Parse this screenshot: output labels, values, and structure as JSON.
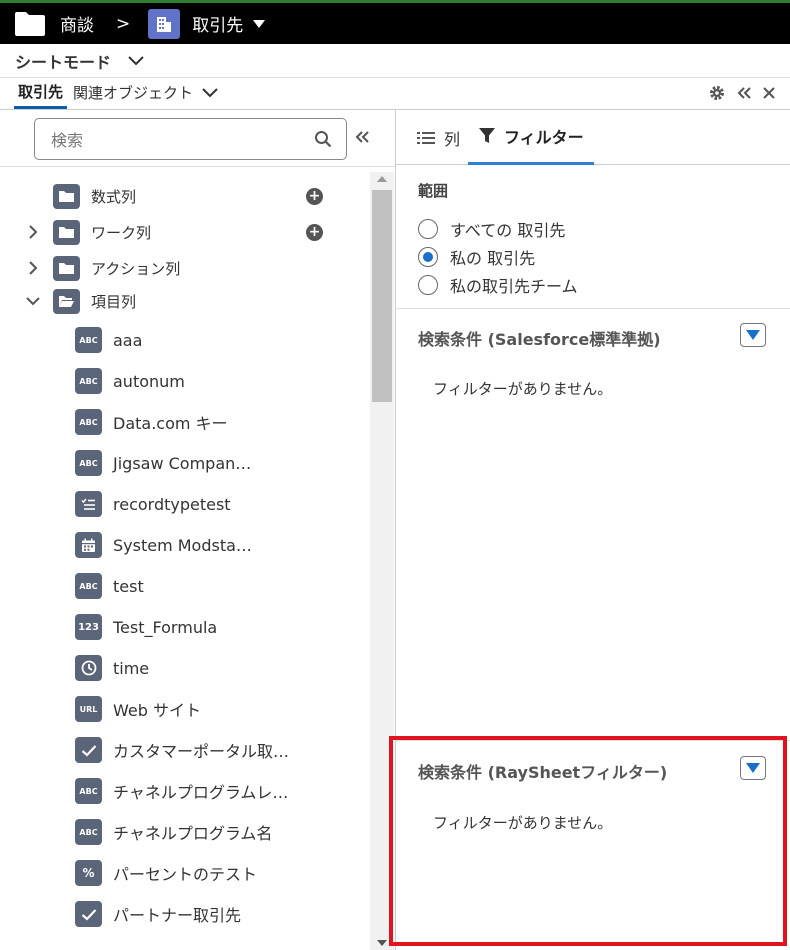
{
  "topbar": {
    "crumb": "商談",
    "separator": ">",
    "object": "取引先"
  },
  "modebar": {
    "label": "シートモード"
  },
  "tabs": {
    "active": "取引先",
    "related": "関連オブジェクト"
  },
  "left": {
    "search_placeholder": "検索",
    "folders": [
      {
        "label": "数式列",
        "expand": "none",
        "add": true
      },
      {
        "label": "ワーク列",
        "expand": "collapsed",
        "add": true
      },
      {
        "label": "アクション列",
        "expand": "collapsed",
        "add": false
      },
      {
        "label": "項目列",
        "expand": "expanded",
        "add": false
      }
    ],
    "fields": [
      {
        "icon": "ABC",
        "label": "aaa"
      },
      {
        "icon": "ABC",
        "label": "autonum"
      },
      {
        "icon": "ABC",
        "label": "Data.com キー"
      },
      {
        "icon": "ABC",
        "label": "Jigsaw Compan…"
      },
      {
        "icon": "list",
        "label": "recordtypetest"
      },
      {
        "icon": "calendar",
        "label": "System Modsta…"
      },
      {
        "icon": "ABC",
        "label": "test"
      },
      {
        "icon": "123",
        "label": "Test_Formula"
      },
      {
        "icon": "clock",
        "label": "time"
      },
      {
        "icon": "URL",
        "label": "Web サイト"
      },
      {
        "icon": "check",
        "label": "カスタマーポータル取…"
      },
      {
        "icon": "ABC",
        "label": "チャネルプログラムレ…"
      },
      {
        "icon": "ABC",
        "label": "チャネルプログラム名"
      },
      {
        "icon": "%",
        "label": "パーセントのテスト"
      },
      {
        "icon": "check",
        "label": "パートナー取引先"
      }
    ]
  },
  "right": {
    "tab_columns": "列",
    "tab_filter": "フィルター",
    "scope_title": "範囲",
    "scope_options": [
      {
        "label": "すべての 取引先",
        "selected": false
      },
      {
        "label": "私の 取引先",
        "selected": true
      },
      {
        "label": "私の取引先チーム",
        "selected": false
      }
    ],
    "cond1_title": "検索条件 (Salesforce標準準拠)",
    "cond1_empty": "フィルターがありません。",
    "cond2_title": "検索条件 (RaySheetフィルター)",
    "cond2_empty": "フィルターがありません。"
  },
  "colors": {
    "accent": "#1b6fc9",
    "highlight": "#e0141e",
    "icon_bg": "#5a6579"
  }
}
